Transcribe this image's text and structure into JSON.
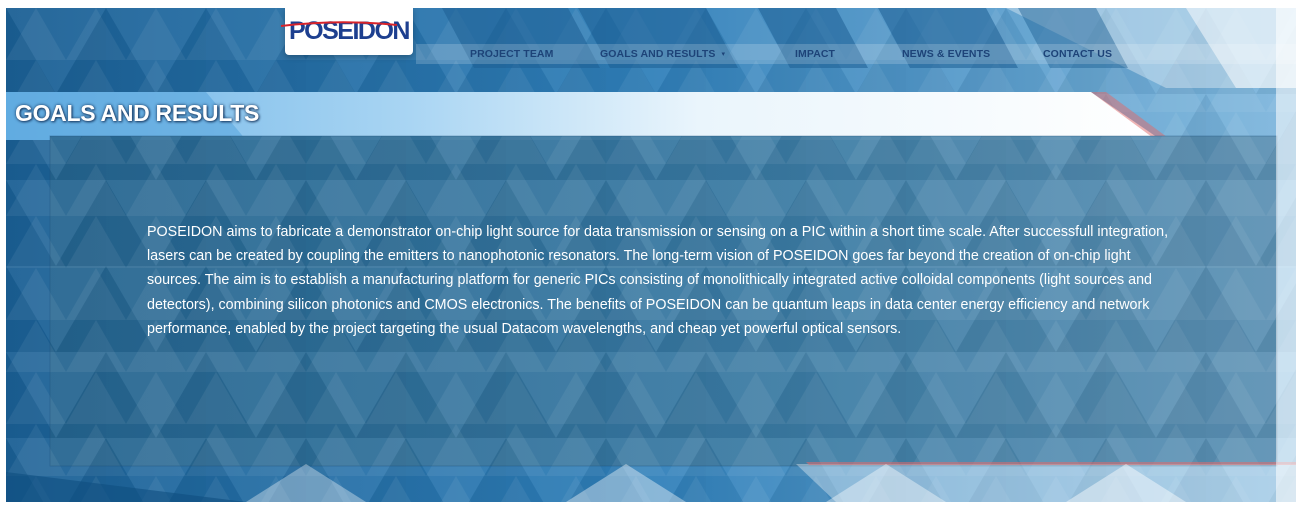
{
  "site": {
    "logo_text": "POSEIDON"
  },
  "nav": {
    "items": [
      {
        "label": "PROJECT TEAM"
      },
      {
        "label": "GOALS AND RESULTS"
      },
      {
        "label": "IMPACT"
      },
      {
        "label": "NEWS & EVENTS"
      },
      {
        "label": "CONTACT US"
      }
    ],
    "dropdown_caret": "▾"
  },
  "page": {
    "title": "GOALS AND RESULTS",
    "body": "POSEIDON aims to fabricate a demonstrator on-chip light source for data transmission or sensing on a PIC within a short time scale. After successfull integration, lasers  can be created by coupling the emitters to nanophotonic resonators. The long-term vision of POSEIDON goes far beyond the creation of on-chip light sources. The aim is to establish a manufacturing platform for generic PICs consisting of monolithically integrated active colloidal components (light sources and detectors), combining silicon photonics and CMOS electronics. The benefits of POSEIDON can be quantum leaps in data center energy efficiency and network performance, enabled by the project targeting the usual Datacom wavelengths, and cheap yet powerful optical sensors."
  },
  "colors": {
    "primary_blue": "#1f6a9c",
    "panel_blue": "#2f6f97",
    "nav_text": "#1d4378",
    "logo_blue": "#1d3f8f",
    "logo_red": "#d8232a",
    "light_blue": "#bfe0f5",
    "accent_red": "#e06a6a"
  }
}
